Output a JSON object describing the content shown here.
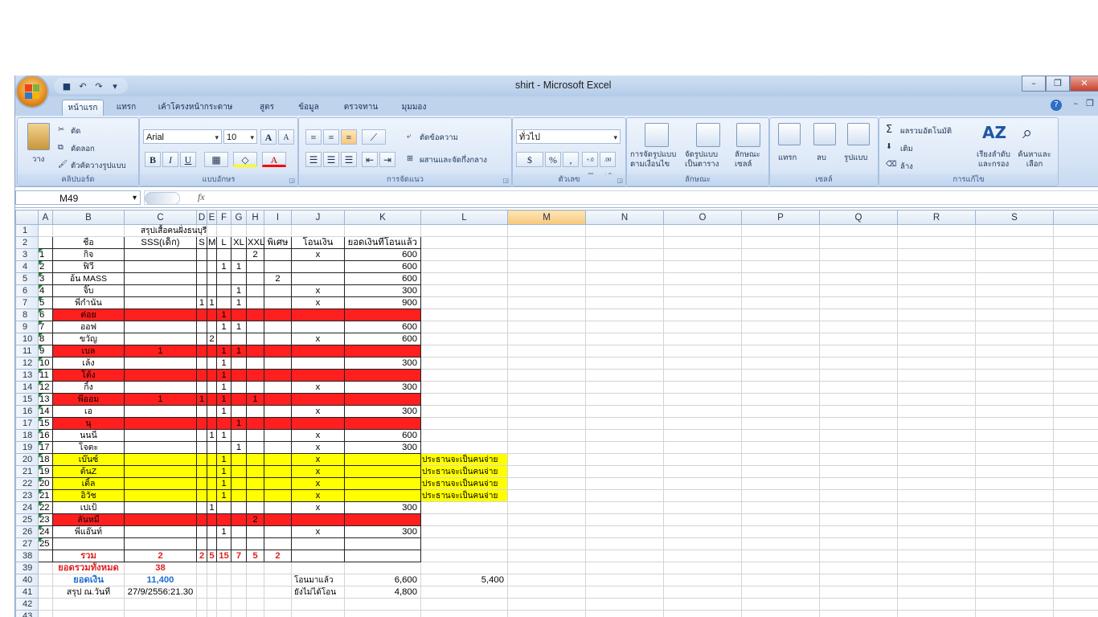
{
  "window": {
    "title": "shirt - Microsoft Excel"
  },
  "ribbon_tabs": [
    "หน้าแรก",
    "แทรก",
    "เค้าโครงหน้ากระดาษ",
    "สูตร",
    "ข้อมูล",
    "ตรวจทาน",
    "มุมมอง"
  ],
  "clipboard": {
    "paste": "วาง",
    "cut": "ตัด",
    "copy": "คัดลอก",
    "format_painter": "ตัวคัดวางรูปแบบ",
    "label": "คลิปบอร์ด"
  },
  "font": {
    "name": "Arial",
    "size": "10",
    "bold": "B",
    "italic": "I",
    "underline": "U",
    "grow": "A",
    "shrink": "A",
    "color_btn": "A",
    "label": "แบบอักษร"
  },
  "alignment": {
    "wrap": "ตัดข้อความ",
    "merge": "ผสานและจัดกึ่งกลาง",
    "label": "การจัดแนว"
  },
  "number": {
    "format": "ทั่วไป",
    "percent": "%",
    "comma": ",",
    "inc_dec": "+.0 .00",
    "dec_dec": ".00 +.0",
    "label": "ตัวเลข"
  },
  "styles": {
    "conditional": "การจัดรูปแบบ ตามเงื่อนไข",
    "table": "จัดรูปแบบ เป็นตาราง",
    "cell": "ลักษณะ เซลล์",
    "label": "ลักษณะ"
  },
  "cells": {
    "insert": "แทรก",
    "delete": "ลบ",
    "format": "รูปแบบ",
    "label": "เซลล์"
  },
  "editing": {
    "autosum": "ผลรวมอัตโนมัติ",
    "fill": "เติม",
    "clear": "ล้าง",
    "sort": "เรียงลำดับ และกรอง",
    "find": "ค้นหาและ เลือก",
    "label": "การแก้ไข"
  },
  "namebox": "M49",
  "fx": "fx",
  "colors": {
    "red": "#ff1f1f",
    "yellow": "#ffff00",
    "total_red": "#e02020",
    "money_blue": "#1e6ed1"
  },
  "columns": [
    "A",
    "B",
    "C",
    "D",
    "E",
    "F",
    "G",
    "H",
    "I",
    "J",
    "K",
    "L",
    "M",
    "N",
    "O",
    "P",
    "Q",
    "R",
    "S"
  ],
  "selected_column": "M",
  "rows": [
    {
      "n": "1",
      "style": "",
      "cells": [
        "",
        "",
        "สรุปเสื้อคนฝั่งธนบุรี",
        "",
        "",
        "",
        "",
        "",
        "",
        "",
        "",
        "",
        ""
      ]
    },
    {
      "n": "2",
      "style": "hdr",
      "cells": [
        "",
        "ชื่อ",
        "SSS(เด็ก)",
        "S",
        "M",
        "L",
        "XL",
        "XXL",
        "พิเศษ",
        "โอนเงิน",
        "ยอดเงินที่โอนแล้ว",
        "",
        ""
      ]
    },
    {
      "n": "3",
      "style": "",
      "cells": [
        "1",
        "กิจ",
        "",
        "",
        "",
        "",
        "",
        "2",
        "",
        "x",
        "600",
        "",
        ""
      ]
    },
    {
      "n": "4",
      "style": "",
      "cells": [
        "2",
        "ฟิวี",
        "",
        "",
        "",
        "1",
        "1",
        "",
        "",
        "",
        "600",
        "",
        ""
      ]
    },
    {
      "n": "5",
      "style": "",
      "cells": [
        "3",
        "อ้น MASS",
        "",
        "",
        "",
        "",
        "",
        "",
        "2",
        "",
        "600",
        "",
        ""
      ]
    },
    {
      "n": "6",
      "style": "",
      "cells": [
        "4",
        "จิ๊บ",
        "",
        "",
        "",
        "",
        "1",
        "",
        "",
        "x",
        "300",
        "",
        ""
      ]
    },
    {
      "n": "7",
      "style": "",
      "cells": [
        "5",
        "พี่กำนัน",
        "",
        "1",
        "1",
        "",
        "1",
        "",
        "",
        "x",
        "900",
        "",
        ""
      ]
    },
    {
      "n": "8",
      "style": "red",
      "cells": [
        "6",
        "ต่อย",
        "",
        "",
        "",
        "1",
        "",
        "",
        "",
        "",
        "",
        "",
        ""
      ]
    },
    {
      "n": "9",
      "style": "",
      "cells": [
        "7",
        "ออฟ",
        "",
        "",
        "",
        "1",
        "1",
        "",
        "",
        "",
        "600",
        "",
        ""
      ]
    },
    {
      "n": "10",
      "style": "",
      "cells": [
        "8",
        "ขวัญ",
        "",
        "",
        "2",
        "",
        "",
        "",
        "",
        "x",
        "600",
        "",
        ""
      ]
    },
    {
      "n": "11",
      "style": "red",
      "cells": [
        "9",
        "เบล",
        "1",
        "",
        "",
        "1",
        "1",
        "",
        "",
        "",
        "",
        "",
        ""
      ]
    },
    {
      "n": "12",
      "style": "",
      "cells": [
        "10",
        "เล้ง",
        "",
        "",
        "",
        "1",
        "",
        "",
        "",
        "",
        "300",
        "",
        ""
      ]
    },
    {
      "n": "13",
      "style": "red",
      "cells": [
        "11",
        "โต้ง",
        "",
        "",
        "",
        "1",
        "",
        "",
        "",
        "",
        "",
        "",
        ""
      ]
    },
    {
      "n": "14",
      "style": "",
      "cells": [
        "12",
        "กิ้ง",
        "",
        "",
        "",
        "1",
        "",
        "",
        "",
        "x",
        "300",
        "",
        ""
      ]
    },
    {
      "n": "15",
      "style": "red",
      "cells": [
        "13",
        "พี่ออม",
        "1",
        "1",
        "",
        "1",
        "",
        "1",
        "",
        "",
        "",
        "",
        ""
      ]
    },
    {
      "n": "16",
      "style": "",
      "cells": [
        "14",
        "เอ",
        "",
        "",
        "",
        "1",
        "",
        "",
        "",
        "x",
        "300",
        "",
        ""
      ]
    },
    {
      "n": "17",
      "style": "red",
      "cells": [
        "15",
        "นุ",
        "",
        "",
        "",
        "",
        "1",
        "",
        "",
        "",
        "",
        "",
        ""
      ]
    },
    {
      "n": "18",
      "style": "",
      "cells": [
        "16",
        "นนนี่",
        "",
        "",
        "1",
        "1",
        "",
        "",
        "",
        "x",
        "600",
        "",
        ""
      ]
    },
    {
      "n": "19",
      "style": "",
      "cells": [
        "17",
        "โจตะ",
        "",
        "",
        "",
        "",
        "1",
        "",
        "",
        "x",
        "300",
        "",
        ""
      ]
    },
    {
      "n": "20",
      "style": "yel",
      "cells": [
        "18",
        "เบ๊นซ์",
        "",
        "",
        "",
        "1",
        "",
        "",
        "",
        "x",
        "",
        "ประธานจะเป็นคนจ่าย",
        ""
      ]
    },
    {
      "n": "21",
      "style": "yel",
      "cells": [
        "19",
        "ต้นZ",
        "",
        "",
        "",
        "1",
        "",
        "",
        "",
        "x",
        "",
        "ประธานจะเป็นคนจ่าย",
        ""
      ]
    },
    {
      "n": "22",
      "style": "yel",
      "cells": [
        "20",
        "เติ้ล",
        "",
        "",
        "",
        "1",
        "",
        "",
        "",
        "x",
        "",
        "ประธานจะเป็นคนจ่าย",
        ""
      ]
    },
    {
      "n": "23",
      "style": "yel",
      "cells": [
        "21",
        "อิวัช",
        "",
        "",
        "",
        "1",
        "",
        "",
        "",
        "x",
        "",
        "ประธานจะเป็นคนจ่าย",
        ""
      ]
    },
    {
      "n": "24",
      "style": "",
      "cells": [
        "22",
        "เปเป้",
        "",
        "",
        "1",
        "",
        "",
        "",
        "",
        "x",
        "300",
        "",
        ""
      ]
    },
    {
      "n": "25",
      "style": "red",
      "cells": [
        "23",
        "ลันหมี",
        "",
        "",
        "",
        "",
        "",
        "2",
        "",
        "",
        "",
        "",
        ""
      ]
    },
    {
      "n": "26",
      "style": "",
      "cells": [
        "24",
        "พี่แอ๊นท์",
        "",
        "",
        "",
        "1",
        "",
        "",
        "",
        "x",
        "300",
        "",
        ""
      ]
    },
    {
      "n": "27",
      "style": "",
      "cells": [
        "25",
        "",
        "",
        "",
        "",
        "",
        "",
        "",
        "",
        "",
        "",
        "",
        ""
      ]
    },
    {
      "n": "38",
      "style": "total",
      "cells": [
        "",
        "รวม",
        "2",
        "2",
        "5",
        "15",
        "7",
        "5",
        "2",
        "",
        "",
        "",
        ""
      ]
    },
    {
      "n": "39",
      "style": "sum",
      "cells": [
        "",
        "ยอดรวมทั้งหมด",
        "38",
        "",
        "",
        "",
        "",
        "",
        "",
        "",
        "",
        "",
        ""
      ]
    },
    {
      "n": "40",
      "style": "money",
      "cells": [
        "",
        "ยอดเงิน",
        "11,400",
        "",
        "",
        "",
        "",
        "",
        "",
        "โอนมาแล้ว",
        "6,600",
        "5,400",
        ""
      ]
    },
    {
      "n": "41",
      "style": "date",
      "cells": [
        "",
        "สรุป ณ.วันที่",
        "27/9/2556:21.30",
        "",
        "",
        "",
        "",
        "",
        "",
        "ยังไม่ได้โอน",
        "4,800",
        "",
        ""
      ]
    },
    {
      "n": "42",
      "style": "",
      "cells": [
        "",
        "",
        "",
        "",
        "",
        "",
        "",
        "",
        "",
        "",
        "",
        "",
        ""
      ]
    },
    {
      "n": "43",
      "style": "",
      "cells": [
        "",
        "",
        "",
        "",
        "",
        "",
        "",
        "",
        "",
        "",
        "",
        "",
        ""
      ]
    }
  ]
}
